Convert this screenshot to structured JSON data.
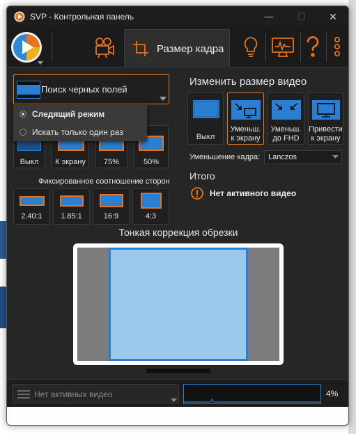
{
  "window": {
    "title": "SVP - Контрольная панель"
  },
  "toolbar": {
    "active_tab_label": "Размер кадра",
    "tabs": [
      "camera-icon",
      "crop-icon",
      "lightbulb-icon",
      "monitor-icon",
      "help-icon",
      "more-icon"
    ]
  },
  "left": {
    "black_bars_label": "Поиск черных полей",
    "popup": {
      "options": [
        {
          "label": "Следящий режим",
          "selected": true
        },
        {
          "label": "Искать только один раз",
          "selected": false
        }
      ]
    },
    "crop_modes": [
      "Выкл",
      "К экрану",
      "75%",
      "50%"
    ],
    "fixed_ratio_heading": "Фиксированное соотношение сторон",
    "ratios": [
      "2.40:1",
      "1.85:1",
      "16:9",
      "4:3"
    ]
  },
  "right": {
    "heading": "Изменить размер видео",
    "resize_options": [
      {
        "line1": "Выкл",
        "line2": "",
        "selected": false
      },
      {
        "line1": "Уменьш.",
        "line2": "к экрану",
        "selected": true
      },
      {
        "line1": "Уменьш.",
        "line2": "до FHD",
        "selected": false
      },
      {
        "line1": "Привести",
        "line2": "к экрану",
        "selected": false
      }
    ],
    "downscale_label": "Уменьшение кадра:",
    "downscale_value": "Lanczos",
    "total_heading": "Итого",
    "total_status": "Нет активного видео"
  },
  "fine_tune": {
    "heading": "Тонкая коррекция обрезки"
  },
  "status": {
    "video_dropdown": "Нет активных видео",
    "cpu_load": "4%"
  },
  "colors": {
    "accent_orange": "#e07a1f",
    "accent_blue": "#2a7fd3",
    "panel_bg": "#262626"
  }
}
